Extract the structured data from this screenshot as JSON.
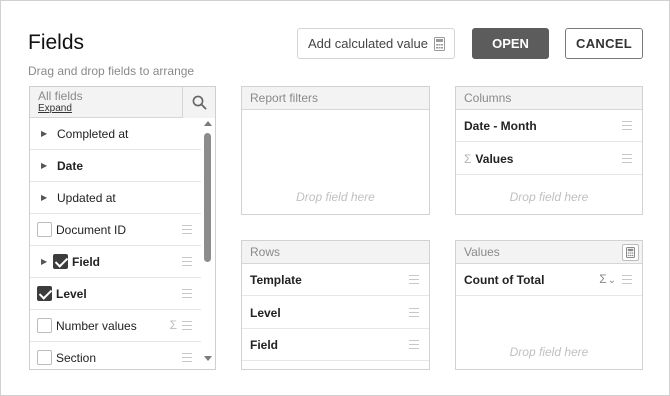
{
  "dialog": {
    "title": "Fields",
    "subtitle": "Drag and drop fields to arrange",
    "calc_button": "Add calculated value",
    "open_button": "OPEN",
    "cancel_button": "CANCEL"
  },
  "fields": {
    "header_label": "All fields",
    "expand_label": "Expand",
    "items": [
      {
        "label": "Completed at",
        "kind": "expandable"
      },
      {
        "label": "Date",
        "kind": "expandable",
        "bold": true
      },
      {
        "label": "Updated at",
        "kind": "expandable"
      },
      {
        "label": "Document ID",
        "kind": "checkbox",
        "checked": false
      },
      {
        "label": "Field",
        "kind": "expandable-checkbox",
        "checked": true,
        "bold": true
      },
      {
        "label": "Level",
        "kind": "checkbox",
        "checked": true,
        "bold": true
      },
      {
        "label": "Number values",
        "kind": "checkbox",
        "checked": false,
        "sigma": true
      },
      {
        "label": "Section",
        "kind": "checkbox",
        "checked": false
      }
    ]
  },
  "report_filters": {
    "header": "Report filters",
    "drop_hint": "Drop field here"
  },
  "columns": {
    "header": "Columns",
    "items": [
      "Date - Month",
      "Values"
    ],
    "drop_hint": "Drop field here"
  },
  "rows": {
    "header": "Rows",
    "items": [
      "Template",
      "Level",
      "Field"
    ]
  },
  "values": {
    "header": "Values",
    "items": [
      "Count of Total"
    ],
    "agg_symbol": "Σ",
    "drop_hint": "Drop field here"
  },
  "glyphs": {
    "sigma": "Σ",
    "arrow_right": "▶",
    "chevron_down": "⌄"
  }
}
